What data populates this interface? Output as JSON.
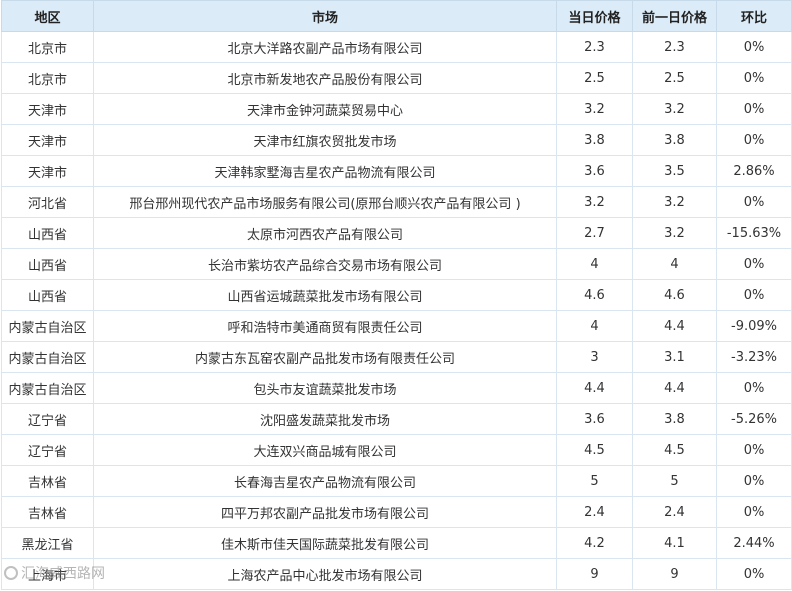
{
  "headers": {
    "region": "地区",
    "market": "市场",
    "today_price": "当日价格",
    "prev_price": "前一日价格",
    "change": "环比"
  },
  "rows": [
    {
      "region": "北京市",
      "market": "北京大洋路农副产品市场有限公司",
      "today": "2.3",
      "prev": "2.3",
      "change": "0%"
    },
    {
      "region": "北京市",
      "market": "北京市新发地农产品股份有限公司",
      "today": "2.5",
      "prev": "2.5",
      "change": "0%"
    },
    {
      "region": "天津市",
      "market": "天津市金钟河蔬菜贸易中心",
      "today": "3.2",
      "prev": "3.2",
      "change": "0%"
    },
    {
      "region": "天津市",
      "market": "天津市红旗农贸批发市场",
      "today": "3.8",
      "prev": "3.8",
      "change": "0%"
    },
    {
      "region": "天津市",
      "market": "天津韩家墅海吉星农产品物流有限公司",
      "today": "3.6",
      "prev": "3.5",
      "change": "2.86%"
    },
    {
      "region": "河北省",
      "market": "邢台邢州现代农产品市场服务有限公司(原邢台顺兴农产品有限公司 )",
      "today": "3.2",
      "prev": "3.2",
      "change": "0%"
    },
    {
      "region": "山西省",
      "market": "太原市河西农产品有限公司",
      "today": "2.7",
      "prev": "3.2",
      "change": "-15.63%"
    },
    {
      "region": "山西省",
      "market": "长治市紫坊农产品综合交易市场有限公司",
      "today": "4",
      "prev": "4",
      "change": "0%"
    },
    {
      "region": "山西省",
      "market": "山西省运城蔬菜批发市场有限公司",
      "today": "4.6",
      "prev": "4.6",
      "change": "0%"
    },
    {
      "region": "内蒙古自治区",
      "market": "呼和浩特市美通商贸有限责任公司",
      "today": "4",
      "prev": "4.4",
      "change": "-9.09%"
    },
    {
      "region": "内蒙古自治区",
      "market": "内蒙古东瓦窑农副产品批发市场有限责任公司",
      "today": "3",
      "prev": "3.1",
      "change": "-3.23%"
    },
    {
      "region": "内蒙古自治区",
      "market": "包头市友谊蔬菜批发市场",
      "today": "4.4",
      "prev": "4.4",
      "change": "0%"
    },
    {
      "region": "辽宁省",
      "market": "沈阳盛发蔬菜批发市场",
      "today": "3.6",
      "prev": "3.8",
      "change": "-5.26%"
    },
    {
      "region": "辽宁省",
      "market": "大连双兴商品城有限公司",
      "today": "4.5",
      "prev": "4.5",
      "change": "0%"
    },
    {
      "region": "吉林省",
      "market": "长春海吉星农产品物流有限公司",
      "today": "5",
      "prev": "5",
      "change": "0%"
    },
    {
      "region": "吉林省",
      "market": "四平万邦农副产品批发市场有限公司",
      "today": "2.4",
      "prev": "2.4",
      "change": "0%"
    },
    {
      "region": "黑龙江省",
      "market": "佳木斯市佳天国际蔬菜批发有限公司",
      "today": "4.2",
      "prev": "4.1",
      "change": "2.44%"
    },
    {
      "region": "上海市",
      "market": "上海农产品中心批发市场有限公司",
      "today": "9",
      "prev": "9",
      "change": "0%"
    }
  ],
  "watermark": "汇海威西路网",
  "icons": {
    "watermark_logo": "circle-logo-icon"
  }
}
